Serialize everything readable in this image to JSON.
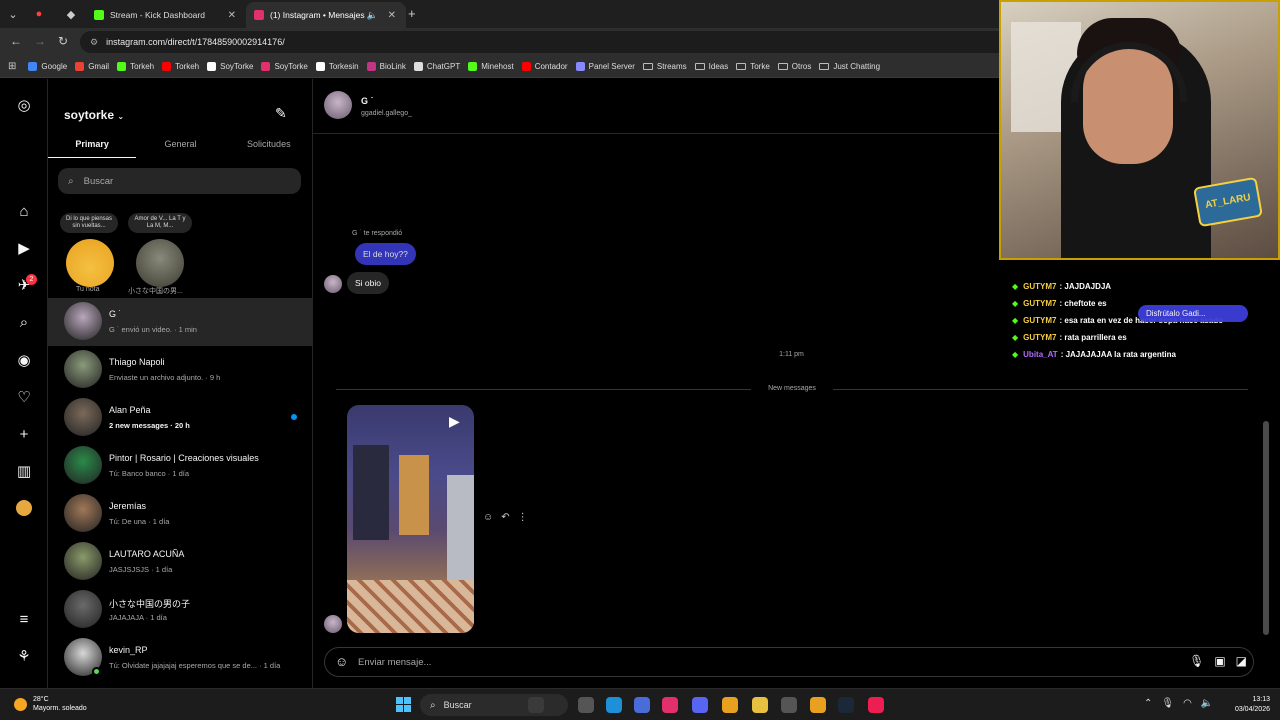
{
  "browser": {
    "tabs": [
      {
        "title": "Stream - Kick Dashboard",
        "color": "#53fc18"
      },
      {
        "title": "(1) Instagram • Mensajes",
        "color": "#e1306c"
      }
    ],
    "url": "instagram.com/direct/t/17848590002914176/",
    "bookmarks": [
      {
        "label": "Google",
        "color": "#4285f4",
        "type": "site"
      },
      {
        "label": "Gmail",
        "color": "#ea4335",
        "type": "site"
      },
      {
        "label": "Torkeh",
        "color": "#53fc18",
        "type": "site"
      },
      {
        "label": "Torkeh",
        "color": "#ff0000",
        "type": "site"
      },
      {
        "label": "SoyTorke",
        "color": "#ffffff",
        "type": "site"
      },
      {
        "label": "SoyTorke",
        "color": "#e1306c",
        "type": "site"
      },
      {
        "label": "Torkesin",
        "color": "#ffffff",
        "type": "site"
      },
      {
        "label": "BioLink",
        "color": "#c13584",
        "type": "site"
      },
      {
        "label": "ChatGPT",
        "color": "#dddddd",
        "type": "site"
      },
      {
        "label": "Minehost",
        "color": "#53fc18",
        "type": "site"
      },
      {
        "label": "Contador",
        "color": "#ff0000",
        "type": "site"
      },
      {
        "label": "Panel Server",
        "color": "#8888ff",
        "type": "site"
      },
      {
        "label": "Streams",
        "type": "folder"
      },
      {
        "label": "Ideas",
        "type": "folder"
      },
      {
        "label": "Torke",
        "type": "folder"
      },
      {
        "label": "Otros",
        "type": "folder"
      },
      {
        "label": "Just Chatting",
        "type": "folder"
      }
    ]
  },
  "inbox": {
    "username": "soytorke",
    "tabs": [
      "Primary",
      "General",
      "Solicitudes"
    ],
    "search_placeholder": "Buscar",
    "notes": [
      {
        "bubble": "Di lo que piensas sin vueltas...",
        "caption": "Tu nota"
      },
      {
        "bubble": "Amor de V... La T y La M, M...",
        "caption": "小さな中国の男..."
      }
    ],
    "conversations": [
      {
        "name": "G ˙",
        "sub": "G ˙ envió un video. · 1 min",
        "selected": true,
        "avatar": "#b9a6bc"
      },
      {
        "name": "Thiago Napoli",
        "sub": "Enviaste un archivo adjunto. · 9 h",
        "avatar": "#8a9a7a"
      },
      {
        "name": "Alan Peña",
        "sub": "2 new messages · 20 h",
        "unread": true,
        "avatar": "#7a6a5a"
      },
      {
        "name": "Pintor | Rosario | Creaciones visuales",
        "sub": "Tú: Banco banco · 1 día",
        "avatar": "#2a8a4a"
      },
      {
        "name": "Jeremías",
        "sub": "Tú: De una · 1 día",
        "avatar": "#a07858"
      },
      {
        "name": "LAUTARO ACUÑA",
        "sub": "JASJSJSJS · 1 día",
        "avatar": "#8a9a6a"
      },
      {
        "name": "小さな中国の男の子",
        "sub": "JAJAJAJA · 1 día",
        "avatar": "#6a6a6a"
      },
      {
        "name": "kevin_RP",
        "sub": "Tú: Olvidate jajajajaj esperemos que se de... · 1 día",
        "online": true,
        "avatar": "#d8d8d8"
      }
    ]
  },
  "chat": {
    "name": "G ˙",
    "handle": "ggadiel.gallego_",
    "replied_label": "G ˙ te respondió",
    "my_message": "El de hoy??",
    "their_message": "Si obio",
    "time": "1:11 pm",
    "new_messages": "New messages",
    "composer_placeholder": "Enviar mensaje..."
  },
  "stream_chat": [
    {
      "user": "GUTYM7",
      "text": ": JAJDAJDJA",
      "color": "#f5d040"
    },
    {
      "user": "GUTYM7",
      "text": ": cheftote es",
      "color": "#f5d040"
    },
    {
      "user": "GUTYM7",
      "text": ": esa rata en vez de hacer sopa hace asado",
      "color": "#f5d040"
    },
    {
      "user": "GUTYM7",
      "text": ": rata parrillera es",
      "color": "#f5d040"
    },
    {
      "user": "Ubita_AT",
      "text": ": JAJAJAJAA la rata argentina",
      "color": "#b36bff"
    }
  ],
  "stream_alert": "Disfrútalo Gadi...",
  "cam_badge": "AT_LARU",
  "taskbar": {
    "temperature": "28°C",
    "weather": "Mayorm. soleado",
    "search": "Buscar",
    "time": "13:13",
    "date": "03/04/2026"
  }
}
